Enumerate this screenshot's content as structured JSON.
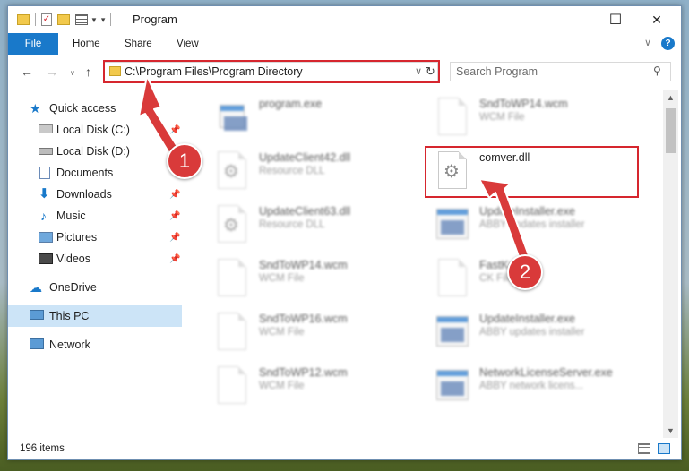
{
  "window": {
    "title": "Program",
    "minimize": "—",
    "maximize": "☐",
    "close": "✕"
  },
  "ribbon": {
    "tabs": [
      "File",
      "Home",
      "Share",
      "View"
    ]
  },
  "address": {
    "path": "C:\\Program Files\\Program Directory"
  },
  "search": {
    "placeholder": "Search Program"
  },
  "sidebar": {
    "items": [
      {
        "label": "Quick access",
        "icon": "star-icon"
      },
      {
        "label": "Local Disk (C:)",
        "icon": "drive-icon"
      },
      {
        "label": "Local Disk (D:)",
        "icon": "drive-icon"
      },
      {
        "label": "Documents",
        "icon": "documents-icon"
      },
      {
        "label": "Downloads",
        "icon": "downloads-icon"
      },
      {
        "label": "Music",
        "icon": "music-icon"
      },
      {
        "label": "Pictures",
        "icon": "pictures-icon"
      },
      {
        "label": "Videos",
        "icon": "videos-icon"
      },
      {
        "label": "OneDrive",
        "icon": "cloud-icon"
      },
      {
        "label": "This PC",
        "icon": "computer-icon"
      },
      {
        "label": "Network",
        "icon": "network-icon"
      }
    ]
  },
  "files": [
    {
      "name": "program.exe",
      "type": ""
    },
    {
      "name": "SndToWP14.wcm",
      "type": "WCM File"
    },
    {
      "name": "UpdateClient42.dll",
      "type": "Resource DLL"
    },
    {
      "name": "comver.dll",
      "type": ""
    },
    {
      "name": "UpdateClient63.dll",
      "type": "Resource DLL"
    },
    {
      "name": "UpdateInstaller.exe",
      "type": "ABBY updates installer"
    },
    {
      "name": "SndToWP14.wcm",
      "type": "WCM File"
    },
    {
      "name": "FastKo...",
      "type": "CK File"
    },
    {
      "name": "SndToWP16.wcm",
      "type": "WCM File"
    },
    {
      "name": "UpdateInstaller.exe",
      "type": "ABBY updates installer"
    },
    {
      "name": "SndToWP12.wcm",
      "type": "WCM File"
    },
    {
      "name": "NetworkLicenseServer.exe",
      "type": "ABBY network licens..."
    }
  ],
  "status": {
    "item_count": "196 items"
  },
  "callouts": [
    "1",
    "2"
  ],
  "colors": {
    "accent": "#1979ca",
    "highlight": "#d6262e",
    "callout": "#d93a3a"
  }
}
